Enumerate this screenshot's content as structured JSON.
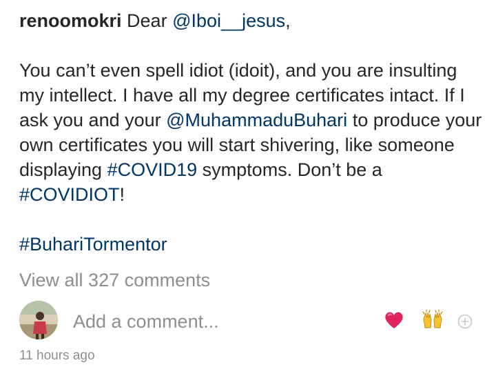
{
  "post": {
    "username": "renoomokri",
    "caption_intro": "Dear",
    "mention_1": "@Iboi__jesus",
    "caption_intro_end": ",",
    "para_1_a": "You can’t even spell idiot (idoit), and you are insulting my intellect. I have all my degree certificates intact. If I ask you and your",
    "mention_2": "@MuhammaduBuhari",
    "para_1_b": "to produce your own certificates you will start shivering, like someone displaying",
    "hashtag_1": "#COVID19",
    "para_1_c": "symptoms. Don’t be a",
    "hashtag_2": "#COVIDIOT",
    "para_1_d": "!",
    "hashtag_3": "#BuhariTormentor"
  },
  "comments": {
    "view_all_label": "View all 327 comments",
    "add_placeholder": "Add a comment..."
  },
  "quick_reactions": {
    "items": [
      {
        "icon": "red-heart-icon",
        "glyph": "❤️",
        "color": "#e0245e"
      },
      {
        "icon": "raising-hands-icon",
        "glyph": "🙌",
        "color": "#f7c531"
      },
      {
        "icon": "add-reaction-icon",
        "glyph": "⊕",
        "color": "#c7c7c7"
      }
    ]
  },
  "timestamp": "11 hours ago",
  "colors": {
    "text": "#262626",
    "link": "#003569",
    "muted": "#8e8e8e"
  }
}
